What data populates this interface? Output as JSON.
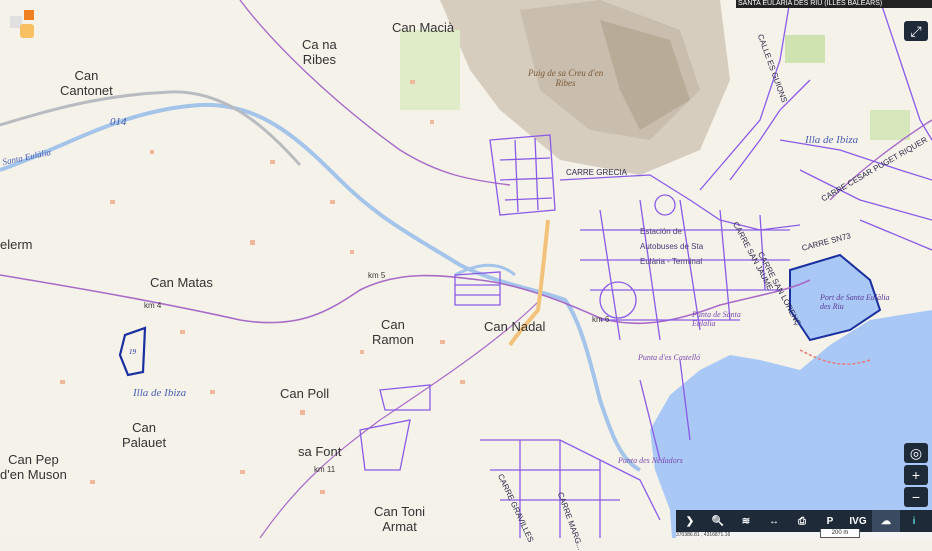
{
  "banner": {
    "text": "SANTA EULÀRIA DES RIU (ILLES BALEARS)"
  },
  "places": {
    "can_macia": "Can Macià",
    "ca_na_ribes": "Ca na\nRibes",
    "can_cantonet": "Can\nCantonet",
    "elerm": "elerm",
    "can_matas": "Can Matas",
    "can_ramon": "Can\nRamon",
    "can_nadal": "Can Nadal",
    "can_poll": "Can Poll",
    "can_palauet": "Can\nPalauet",
    "can_pep_en_muson": "Can Pep\nd'en Muson",
    "sa_font": "sa Font",
    "can_toni_armat": "Can Toni\nArmat"
  },
  "peak": "Puig de sa Creu d'en\nRibes",
  "labels": {
    "santa_eulalia_river": "Santa Eulàlia",
    "illa_ibiza_w": "Illa de Ibiza",
    "illa_ibiza_e": "Illa de Ibiza",
    "road_014": "014",
    "parcel_19": "19",
    "km4": "km 4",
    "km5": "km 5",
    "km6": "km 6",
    "km11": "km 11",
    "port": "Port de Santa Eulàlia\ndes Riu",
    "punta_castello": "Punta d'es Castelló",
    "punta_santa": "Punta de Santa\nEulàlia",
    "nedadors": "Punta des Nedadors",
    "estacion": "Estación de\nAutobuses de Sta\nEulària - Terminal"
  },
  "streets": {
    "grecia": "CARRE GRECIA",
    "san_jaume": "CARRE SAN JAUME",
    "sant_lorenc": "CARRE SAN LORENÇ",
    "cesar_puget": "CARRE CESAR PUGET RIQUER",
    "ses_guions": "CALLE ES GUIONS",
    "sn73": "CARRE SN73",
    "gravilles": "CARRE GRAVILLES",
    "margarita": "CARRE MARG..."
  },
  "controls": {
    "fullscreen": "⤢",
    "locate": "◎",
    "zoom_in": "+",
    "zoom_out": "−"
  },
  "toolbar": {
    "expand": "❯",
    "search": "🔍",
    "layers": "≋",
    "measure": "↔",
    "print": "⎙",
    "parking": "P",
    "ivg": "IVG",
    "basemap": "☁",
    "info": "i"
  },
  "status": {
    "coords": "370386.81 , 4316871.16"
  },
  "scale": {
    "label": "200 m"
  },
  "colors": {
    "street": "#8a5be8",
    "water": "#a9c8f5",
    "road_primary": "#a86bc8",
    "terrain": "#d8d0c4"
  }
}
